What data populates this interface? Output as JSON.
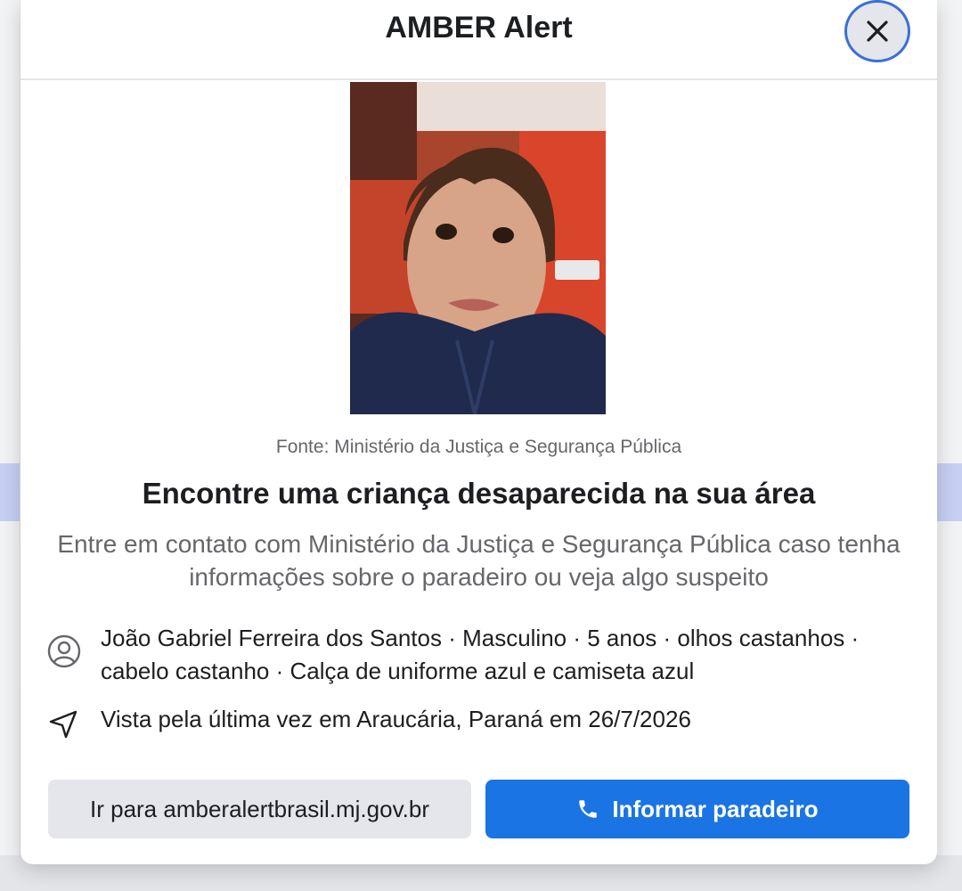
{
  "dialog": {
    "title": "AMBER Alert",
    "source": "Fonte: Ministério da Justiça e Segurança Pública",
    "headline": "Encontre uma criança desaparecida na sua área",
    "description": "Entre em contato com Ministério da Justiça e Segurança Pública caso tenha informações sobre o paradeiro ou veja algo suspeito",
    "details": "João Gabriel Ferreira dos Santos · Masculino · 5 anos · olhos castanhos · cabelo castanho · Calça de uniforme azul e camiseta azul",
    "last_seen": "Vista pela última vez em Araucária, Paraná em 26/7/2026",
    "buttons": {
      "website": "Ir para amberalertbrasil.mj.gov.br",
      "report": "Informar paradeiro"
    }
  },
  "colors": {
    "primary": "#1b74e4",
    "secondary_bg": "#e4e6eb",
    "muted_text": "#65676b"
  },
  "icons": [
    "close-icon",
    "person-icon",
    "location-arrow-icon",
    "phone-icon"
  ]
}
